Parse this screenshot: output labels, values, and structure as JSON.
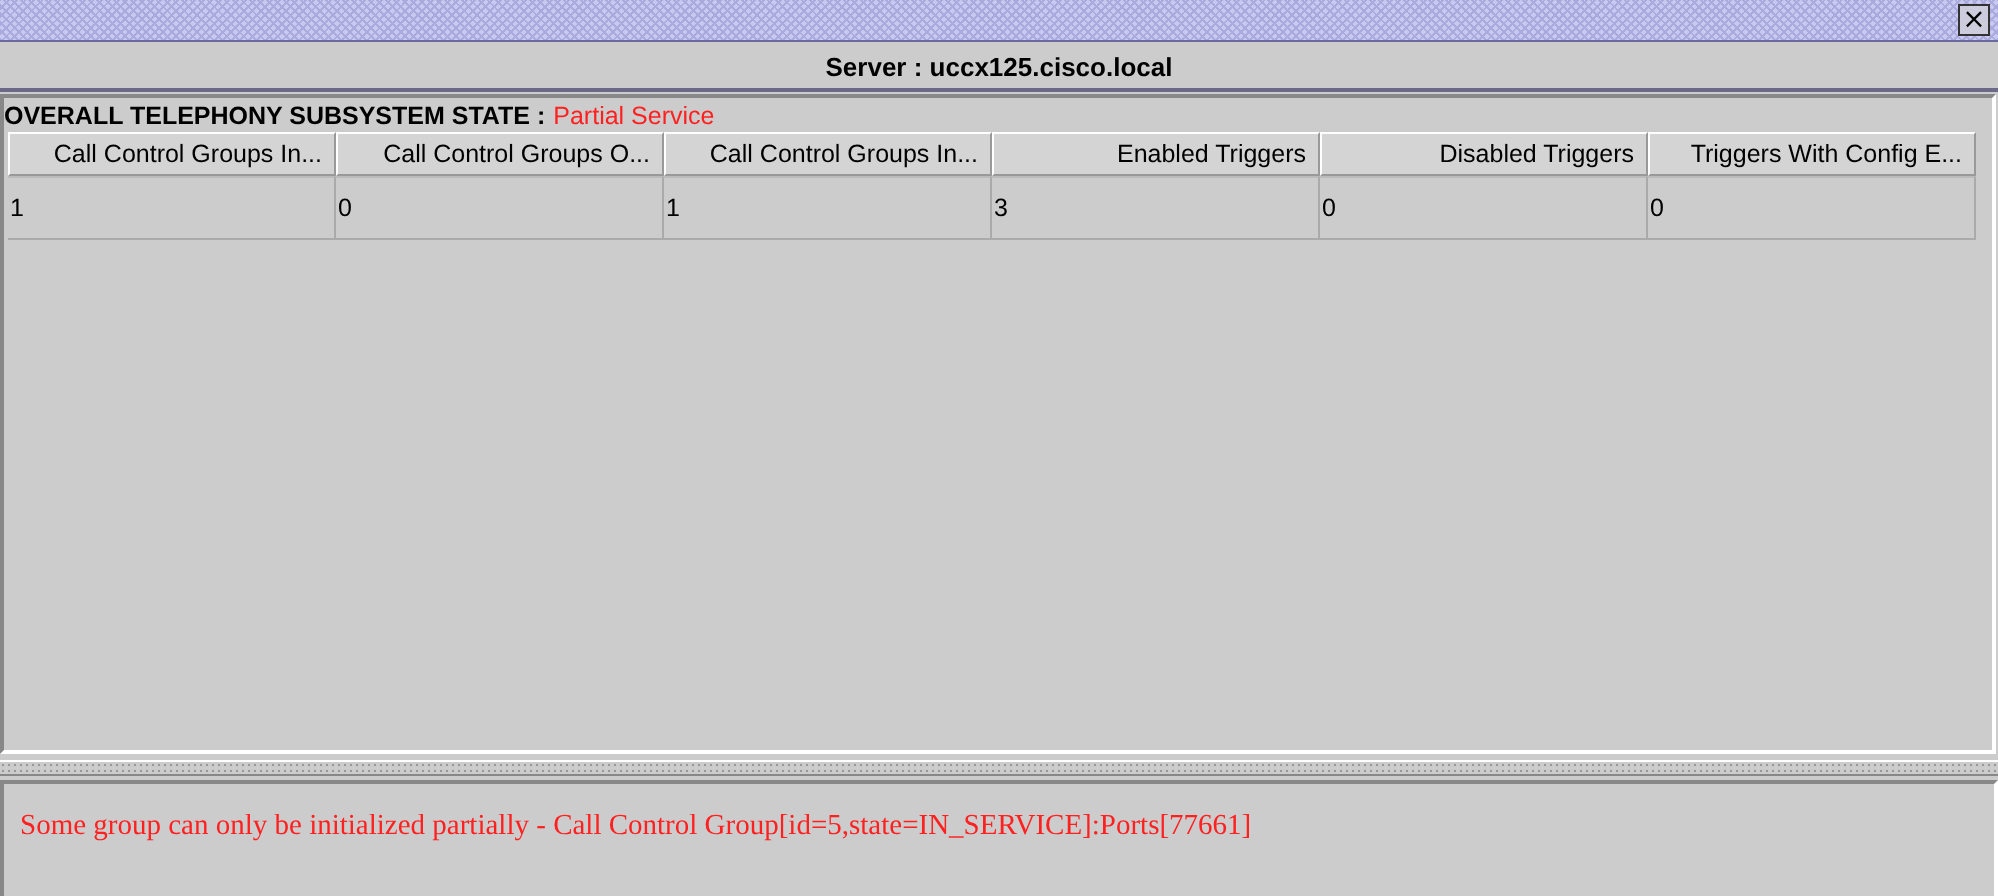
{
  "window": {
    "close": "×"
  },
  "server": {
    "label": "Server : uccx125.cisco.local"
  },
  "state": {
    "label": "OVERALL TELEPHONY SUBSYSTEM STATE :",
    "value": "Partial Service"
  },
  "table": {
    "columns": [
      "Call Control Groups In...",
      "Call Control Groups O...",
      "Call Control Groups In...",
      "Enabled Triggers",
      "Disabled Triggers",
      "Triggers With Config E..."
    ],
    "rows": [
      [
        "1",
        "0",
        "1",
        "3",
        "0",
        "0"
      ]
    ]
  },
  "message": "Some group can only be initialized partially - Call Control Group[id=5,state=IN_SERVICE]:Ports[77661]"
}
